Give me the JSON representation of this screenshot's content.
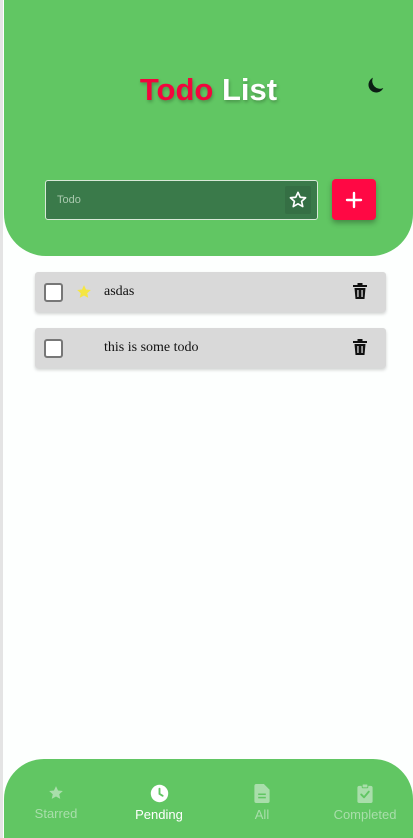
{
  "header": {
    "title_part1": "Todo",
    "title_part2": "List",
    "title_colors": {
      "part1": "#f2063d",
      "part2": "#ffffff"
    },
    "theme_icon": "moon-icon"
  },
  "input": {
    "placeholder": "Todo",
    "value": "",
    "star_icon": "star-outline-icon",
    "add_icon": "plus-icon"
  },
  "todos": [
    {
      "text": "asdas",
      "checked": false,
      "starred": true
    },
    {
      "text": "this is some todo",
      "checked": false,
      "starred": false
    }
  ],
  "nav": {
    "items": [
      {
        "label": "Starred",
        "icon": "star-icon",
        "active": false
      },
      {
        "label": "Pending",
        "icon": "clock-icon",
        "active": true
      },
      {
        "label": "All",
        "icon": "document-icon",
        "active": false
      },
      {
        "label": "Completed",
        "icon": "clipboard-check-icon",
        "active": false
      }
    ]
  },
  "colors": {
    "primary_green": "#61c663",
    "accent_red": "#ff0844",
    "item_bg": "#d9d9d9",
    "star_yellow": "#f5e642"
  }
}
